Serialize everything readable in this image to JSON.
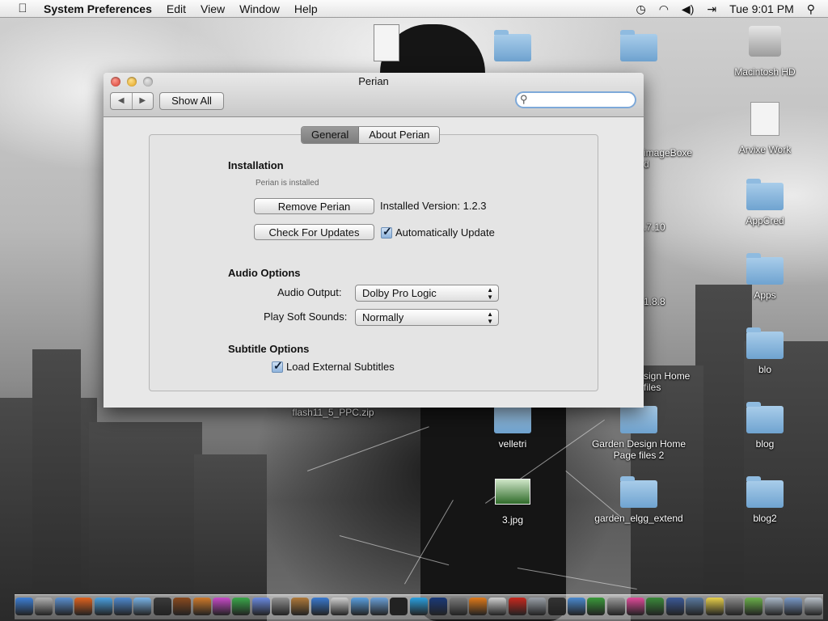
{
  "menubar": {
    "apple_icon": "apple-icon",
    "app_name": "System Preferences",
    "menus": [
      "Edit",
      "View",
      "Window",
      "Help"
    ],
    "clock": "Tue 9:01 PM",
    "status_icons": [
      "time-machine-icon",
      "wifi-icon",
      "volume-icon",
      "input-source-icon",
      "spotlight-icon"
    ]
  },
  "desktop": {
    "icons": [
      {
        "label": "Macintosh HD",
        "icon": "hard-drive-icon"
      },
      {
        "label": "Arvixe Work",
        "icon": "document-icon"
      },
      {
        "label": "AppCred",
        "icon": "folder-icon"
      },
      {
        "label": "Apps",
        "icon": "folder-icon"
      },
      {
        "label": "blo",
        "icon": "folder-icon"
      },
      {
        "label": "blog",
        "icon": "folder-icon"
      },
      {
        "label": "blog2",
        "icon": "folder-icon"
      },
      {
        "label": "velletri",
        "icon": "folder-icon"
      },
      {
        "label": "Garden Design Home Page files 2",
        "icon": "folder-icon"
      },
      {
        "label": "3.jpg",
        "icon": "image-icon"
      },
      {
        "label": "garden_elgg_extend",
        "icon": "folder-icon"
      },
      {
        "label": "flash11_5_PPC.zip",
        "icon": "zip-icon"
      },
      {
        "label": "Blogstylo2012",
        "icon": "folder-icon"
      },
      {
        "label": "imageBoxe\nd",
        "icon": "folder-icon"
      },
      {
        "label": ".7.10",
        "icon": "folder-icon"
      },
      {
        "label": "1.8.8",
        "icon": "folder-icon"
      },
      {
        "label": "sign Home\nfiles",
        "icon": "folder-icon"
      }
    ]
  },
  "window": {
    "title": "Perian",
    "show_all": "Show All",
    "back_icon": "back-arrow-icon",
    "forward_icon": "forward-arrow-icon",
    "search_placeholder": "",
    "tabs": [
      {
        "label": "General",
        "selected": true
      },
      {
        "label": "About Perian",
        "selected": false
      }
    ],
    "installation": {
      "heading": "Installation",
      "status": "Perian is installed",
      "remove_button": "Remove Perian",
      "installed_version": "Installed Version: 1.2.3",
      "check_button": "Check For Updates",
      "auto_update_label": "Automatically Update",
      "auto_update_checked": true
    },
    "audio": {
      "heading": "Audio Options",
      "output_label": "Audio Output:",
      "output_value": "Dolby Pro Logic",
      "soft_label": "Play Soft Sounds:",
      "soft_value": "Normally"
    },
    "subtitles": {
      "heading": "Subtitle Options",
      "load_label": "Load External Subtitles",
      "load_checked": true
    }
  },
  "dock": {
    "icons": [
      "finder-icon",
      "launchpad-icon",
      "preview-icon",
      "firefox-icon",
      "safari-icon",
      "messenger-icon",
      "itunes-icon",
      "dashboard-icon",
      "football-icon",
      "wordpress-icon",
      "ftp-icon",
      "leaf-icon",
      "nvu-icon",
      "preferences-icon",
      "guitar-icon",
      "qq-icon",
      "mail-icon",
      "chat-icon",
      "folder-icon",
      "terminal-icon",
      "skype-icon",
      "photoshop-icon",
      "chess-icon",
      "vlc-icon",
      "calculator-icon",
      "filezilla-icon",
      "migration-icon",
      "camera-icon",
      "finder-icon",
      "vuze-icon",
      "keychain-icon",
      "flickr-icon",
      "tree-icon",
      "facebook-icon",
      "photo-icon",
      "stickies-icon",
      "system-prefs-icon",
      "play-icon",
      "documents-icon",
      "downloads-icon",
      "trash-icon"
    ]
  }
}
